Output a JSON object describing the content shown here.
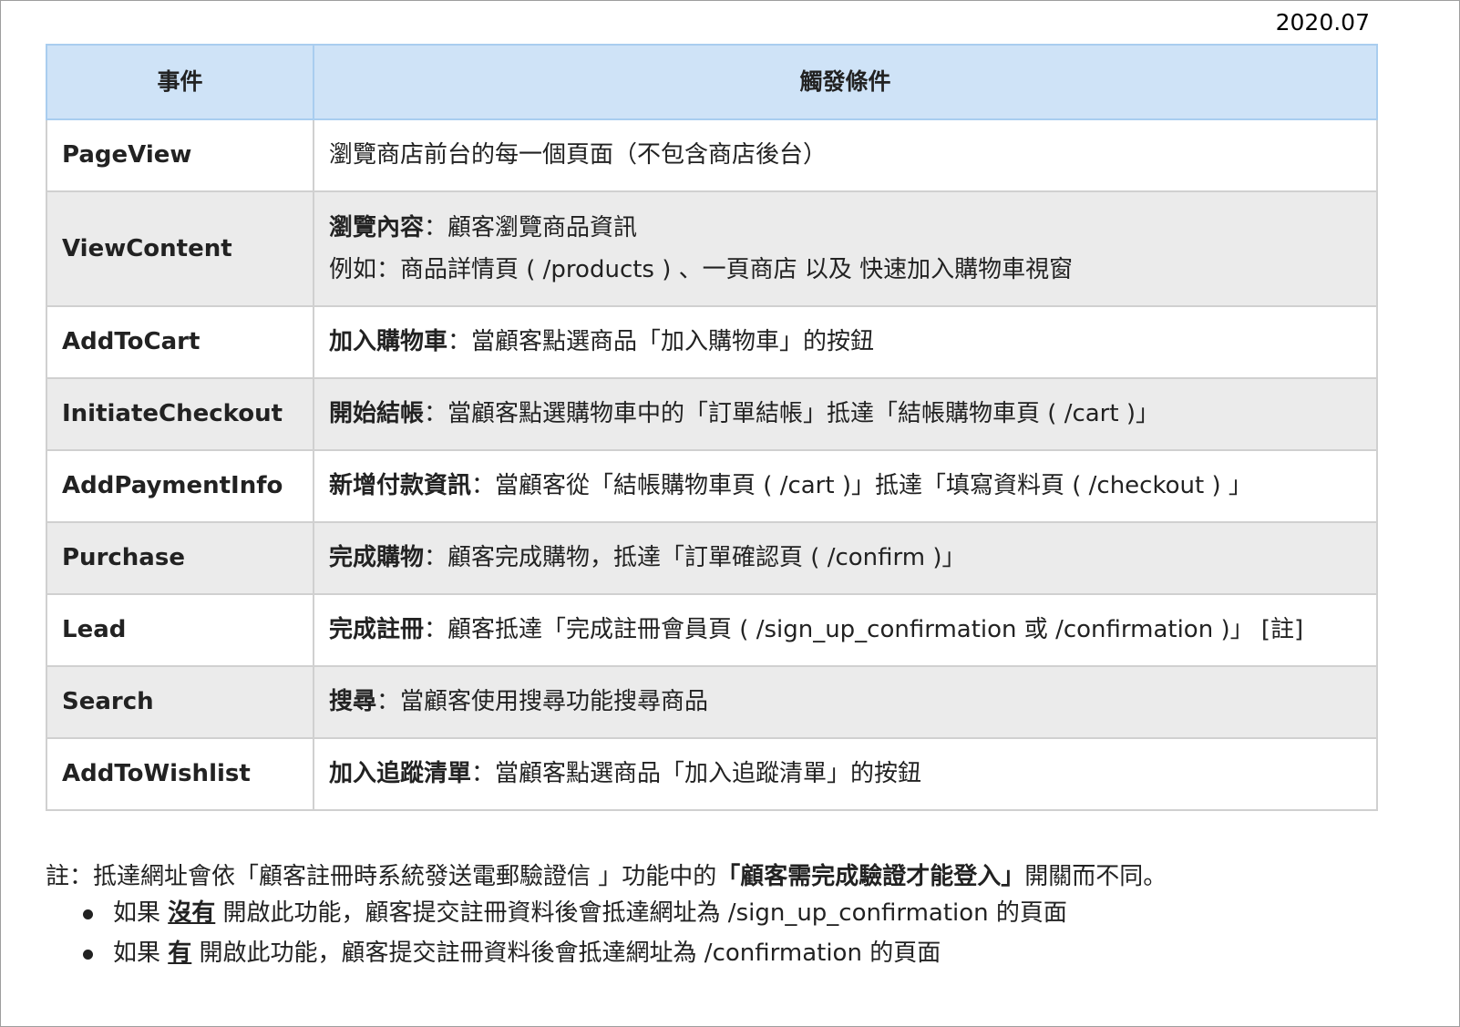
{
  "date": "2020.07",
  "table": {
    "headers": [
      "事件",
      "觸發條件"
    ],
    "rows": [
      {
        "event": "PageView",
        "term": "",
        "desc": "瀏覽商店前台的每一個頁面（不包含商店後台）",
        "desc2": ""
      },
      {
        "event": "ViewContent",
        "term": "瀏覽內容",
        "desc": "：顧客瀏覽商品資訊",
        "desc2": "例如：商品詳情頁 ( /products ) 、一頁商店 以及 快速加入購物車視窗"
      },
      {
        "event": "AddToCart",
        "term": "加入購物車",
        "desc": "：當顧客點選商品「加入購物車」的按鈕",
        "desc2": ""
      },
      {
        "event": "InitiateCheckout",
        "term": "開始結帳",
        "desc": "：當顧客點選購物車中的「訂單結帳」抵達「結帳購物車頁 ( /cart )」",
        "desc2": ""
      },
      {
        "event": "AddPaymentInfo",
        "term": "新增付款資訊",
        "desc": "：當顧客從「結帳購物車頁 ( /cart )」抵達「填寫資料頁 ( /checkout ) 」",
        "desc2": ""
      },
      {
        "event": "Purchase",
        "term": "完成購物",
        "desc": "：顧客完成購物，抵達「訂單確認頁 ( /confirm )」",
        "desc2": ""
      },
      {
        "event": "Lead",
        "term": "完成註冊",
        "desc": "：顧客抵達「完成註冊會員頁 ( /sign_up_confirmation 或 /confirmation )」 [註]",
        "desc2": ""
      },
      {
        "event": "Search",
        "term": "搜尋",
        "desc": "：當顧客使用搜尋功能搜尋商品",
        "desc2": ""
      },
      {
        "event": "AddToWishlist",
        "term": "加入追蹤清單",
        "desc": "：當顧客點選商品「加入追蹤清單」的按鈕",
        "desc2": ""
      }
    ]
  },
  "note": {
    "prefix": "註：抵達網址會依「顧客註冊時系統發送電郵驗證信 」功能中的",
    "bold": "「顧客需完成驗證才能登入」",
    "suffix": "開關而不同。",
    "bullets": [
      {
        "pre": "如果 ",
        "em": "沒有",
        "post": " 開啟此功能，顧客提交註冊資料後會抵達網址為 /sign_up_confirmation 的頁面"
      },
      {
        "pre": "如果 ",
        "em": "有",
        "post": " 開啟此功能，顧客提交註冊資料後會抵達網址為 /confirmation 的頁面"
      }
    ]
  }
}
